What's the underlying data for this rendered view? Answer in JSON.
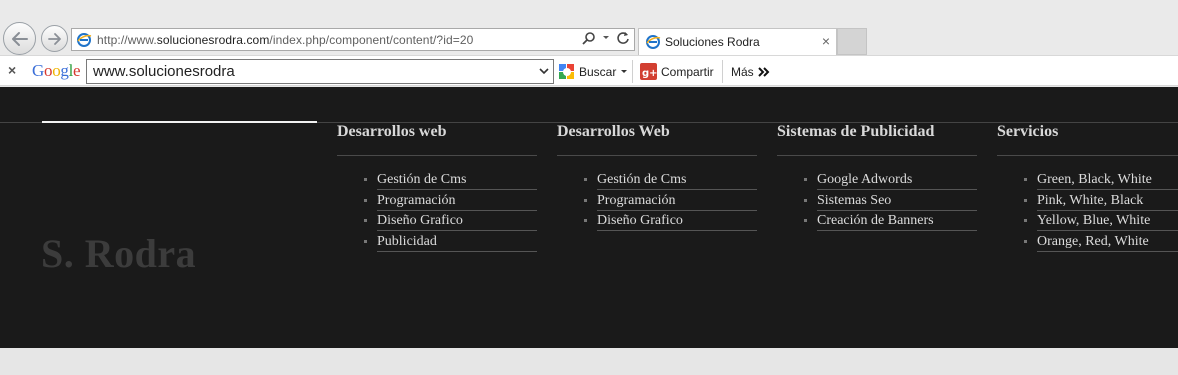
{
  "browser": {
    "url_prefix": "http://www.",
    "url_host": "solucionesrodra.com",
    "url_path": "/index.php/component/content/?id=20",
    "tab_title": "Soluciones Rodra",
    "tab_close_glyph": "×"
  },
  "google_toolbar": {
    "close_glyph": "×",
    "logo_letters": [
      {
        "ch": "G",
        "color": "#3b6fd8"
      },
      {
        "ch": "o",
        "color": "#d6382e"
      },
      {
        "ch": "o",
        "color": "#f0b400"
      },
      {
        "ch": "g",
        "color": "#3b6fd8"
      },
      {
        "ch": "l",
        "color": "#2e9e3e"
      },
      {
        "ch": "e",
        "color": "#d6382e"
      }
    ],
    "search_value": "www.solucionesrodra",
    "buscar_label": "Buscar",
    "compartir_label": "Compartir",
    "mas_label": "Más"
  },
  "site": {
    "logo": "S. Rodra",
    "menus": [
      {
        "heading": "Desarrollos web",
        "items": [
          "Gestión de Cms",
          "Programación",
          "Diseño Grafico",
          "Publicidad"
        ]
      },
      {
        "heading": "Desarrollos Web",
        "items": [
          "Gestión de Cms",
          "Programación",
          "Diseño Grafico"
        ]
      },
      {
        "heading": "Sistemas de Publicidad",
        "items": [
          "Google Adwords",
          "Sistemas Seo",
          "Creación de Banners"
        ]
      },
      {
        "heading": "Servicios",
        "items": [
          "Green, Black, White",
          "Pink, White, Black",
          "Yellow, Blue, White",
          "Orange, Red, White"
        ]
      }
    ]
  },
  "icons": {
    "back": "back-arrow-icon",
    "forward": "forward-arrow-icon",
    "page": "ie-page-icon",
    "search": "search-icon",
    "refresh": "refresh-icon",
    "buscar": "google-buscar-icon",
    "compartir": "google-plus-share-icon",
    "mas": "double-chevron-icon"
  },
  "colors": {
    "site_background": "#1a1a1a",
    "menu_text": "#dcdcdc",
    "logo_text": "#3c3c3c"
  }
}
